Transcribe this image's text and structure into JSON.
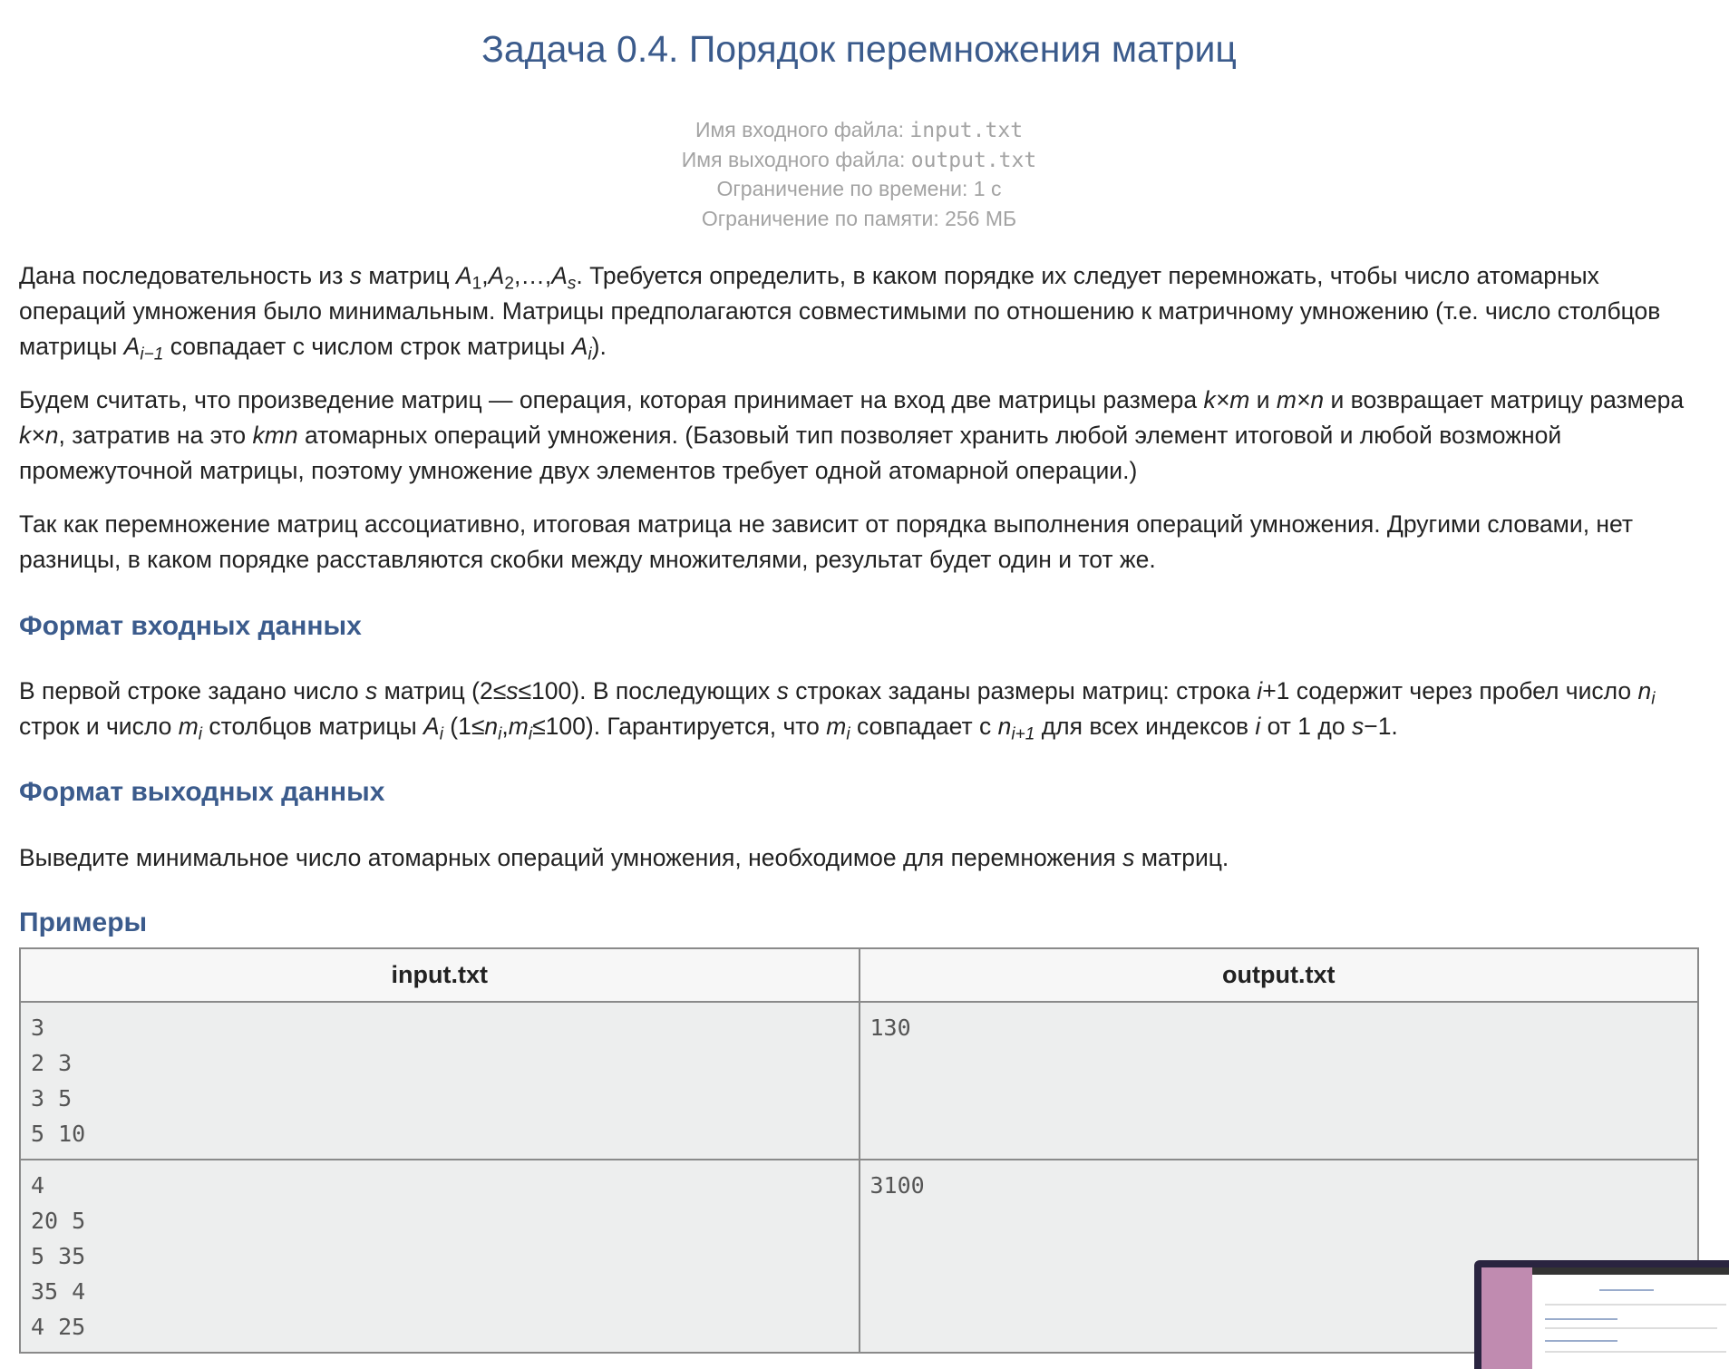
{
  "title": "Задача 0.4. Порядок перемножения матриц",
  "meta": {
    "input_label": "Имя входного файла: ",
    "input_file": "input.txt",
    "output_label": "Имя выходного файла: ",
    "output_file": "output.txt",
    "time_limit": "Ограничение по времени: 1 с",
    "memory_limit": "Ограничение по памяти: 256 МБ"
  },
  "statement": {
    "p1": {
      "t1": "Дана последовательность из ",
      "s": "s",
      "t2": " матриц ",
      "A": "A",
      "sub1": "1",
      "sub2": "2",
      "dots": ",…,",
      "subs": "s",
      "t3": ". Требуется определить, в каком порядке их следует перемножать, чтобы число атомарных операций умножения было минимальным. Матрицы предполагаются совместимыми по отношению к матричному умножению (т.е. число столбцов матрицы ",
      "subim1": "i−1",
      "t4": " совпадает с числом строк матрицы ",
      "subi": "i",
      "t5": ")."
    },
    "p2": {
      "t1": "Будем считать, что произведение матриц — операция, которая принимает на вход две матрицы размера ",
      "km": "k×m",
      "and": " и ",
      "mn": "m×n",
      "t2": " и возвращает матрицу размера ",
      "kn": "k×n",
      "t3": ", затратив на это ",
      "kmn": "kmn",
      "t4": " атомарных операций умножения. (Базовый тип позволяет хранить любой элемент итоговой и любой возможной промежуточной матрицы, поэтому умножение двух элементов требует одной атомарной операции.)"
    },
    "p3": "Так как перемножение матриц ассоциативно, итоговая матрица не зависит от порядка выполнения операций умножения. Другими словами, нет разницы, в каком порядке расставляются скобки между множителями, результат будет один и тот же."
  },
  "input_format": {
    "heading": "Формат входных данных",
    "t1": "В первой строке задано число ",
    "s": "s",
    "t2": " матриц (2≤",
    "t3": "≤100). В последующих ",
    "t4": " строках заданы размеры матриц: строка ",
    "i": "i",
    "t5": "+1 содержит через пробел число ",
    "n": "n",
    "t6": " строк и число ",
    "m": "m",
    "t7": " столбцов матрицы ",
    "A": "A",
    "t8": " (1≤",
    "comma": ",",
    "t9": "≤100). Гарантируется, что ",
    "t10": " совпадает с ",
    "subip1": "i+1",
    "t11": " для всех индексов ",
    "t12": " от 1 до ",
    "t13": "−1."
  },
  "output_format": {
    "heading": "Формат выходных данных",
    "t1": "Выведите минимальное число атомарных операций умножения, необходимое для перемножения ",
    "s": "s",
    "t2": " матриц."
  },
  "examples": {
    "heading": "Примеры",
    "col_input": "input.txt",
    "col_output": "output.txt",
    "rows": [
      {
        "input": "3\n2 3\n3 5\n5 10",
        "output": "130"
      },
      {
        "input": "4\n20 5\n5 35\n35 4\n4 25",
        "output": "3100"
      }
    ]
  }
}
